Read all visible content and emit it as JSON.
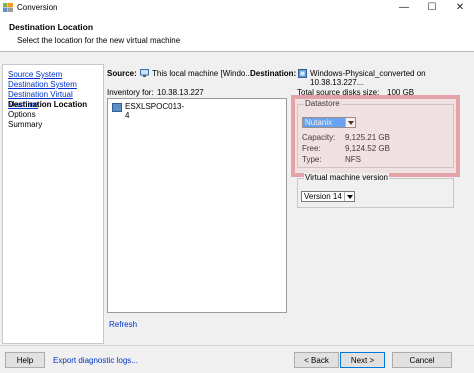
{
  "window": {
    "title": "Conversion",
    "icon": "vmware-converter-icon",
    "controls": {
      "minimize": "—",
      "maximize": "☐",
      "close": "✕"
    }
  },
  "header": {
    "title": "Destination Location",
    "subtitle": "Select the location for the new virtual machine"
  },
  "nav": {
    "items": [
      {
        "label": "Source System",
        "state": "link"
      },
      {
        "label": "Destination System",
        "state": "link"
      },
      {
        "label": "Destination Virtual Machine",
        "state": "link"
      },
      {
        "label": "Destination Location",
        "state": "current"
      },
      {
        "label": "Options",
        "state": "plain"
      },
      {
        "label": "Summary",
        "state": "plain"
      }
    ]
  },
  "summary_line": {
    "source_label": "Source:",
    "source_value": "This local machine [Windo...",
    "destination_label": "Destination:",
    "destination_value": "Windows-Physical_converted on 10.38.13.227..."
  },
  "inventory": {
    "label": "Inventory for:",
    "host": "10.38.13.227",
    "items": [
      "ESXLSPOC013-4"
    ],
    "refresh": "Refresh"
  },
  "disks": {
    "label": "Total source disks size:",
    "value": "100 GB"
  },
  "datastore": {
    "group_title": "Datastore",
    "selected": "Nutanix",
    "capacity_label": "Capacity:",
    "capacity_value": "9,125.21 GB",
    "free_label": "Free:",
    "free_value": "9,124.52 GB",
    "type_label": "Type:",
    "type_value": "NFS"
  },
  "vm_version": {
    "group_title": "Virtual machine version",
    "selected": "Version 14"
  },
  "footer": {
    "help": "Help",
    "export_logs": "Export diagnostic logs...",
    "back": "< Back",
    "next": "Next >",
    "cancel": "Cancel"
  },
  "colors": {
    "link": "#0033cc",
    "highlight": "#dc7882",
    "selection": "#3399ff"
  }
}
